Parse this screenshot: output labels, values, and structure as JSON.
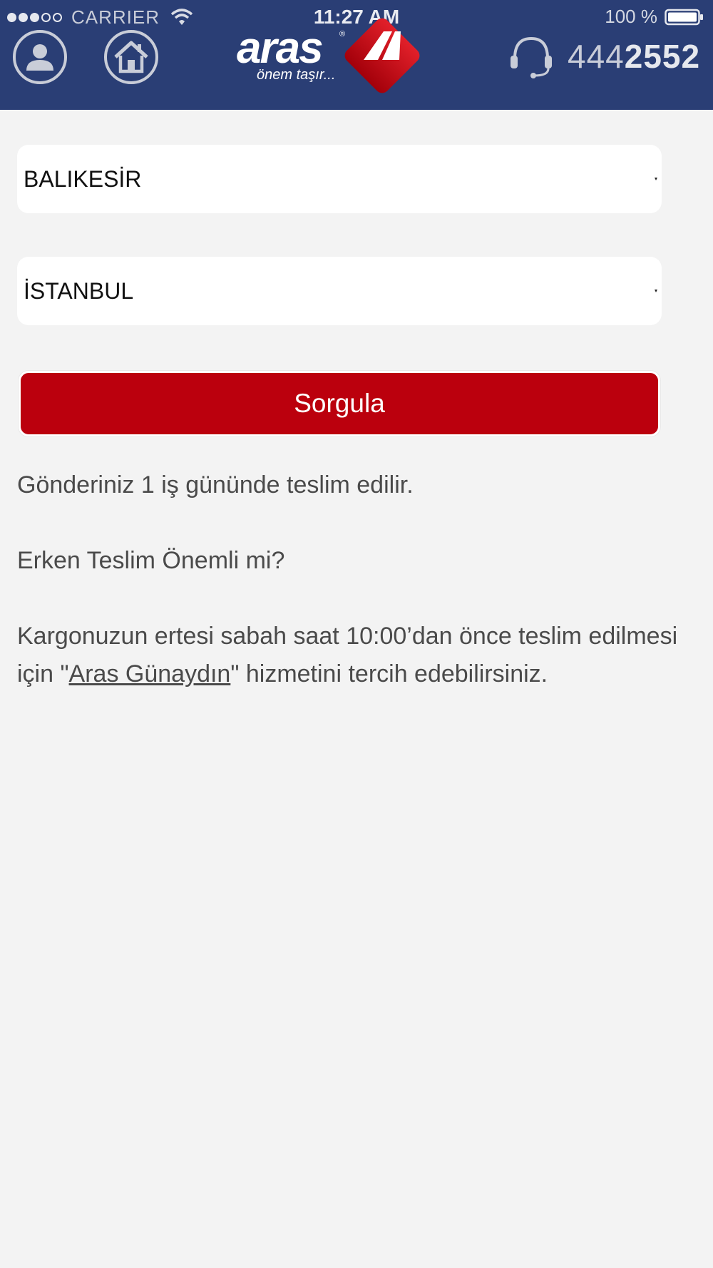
{
  "status_bar": {
    "carrier": "CARRIER",
    "time": "11:27 AM",
    "battery": "100 %",
    "signal_bars_filled": 3,
    "signal_bars_total": 5
  },
  "header": {
    "logo_text": "aras",
    "logo_registered": "®",
    "logo_tagline": "önem taşır...",
    "phone_prefix": "444",
    "phone_suffix": "2552",
    "background_color": "#2a3e75"
  },
  "form": {
    "origin_city": "BALIKESİR",
    "destination_city": "İSTANBUL",
    "submit_label": "Sorgula",
    "submit_color": "#bb000d"
  },
  "info": {
    "delivery_message": "Gönderiniz 1 iş gününde teslim edilir.",
    "early_question": "Erken Teslim Önemli mi?",
    "promo_prefix": "Kargonuzun ertesi sabah saat 10:00’dan önce teslim edilmesi için \"",
    "promo_link": "Aras Günaydın",
    "promo_suffix": "\" hizmetini tercih edebilirsiniz."
  },
  "icons": {
    "profile": "user-icon",
    "home": "home-icon",
    "support": "headset-icon",
    "wifi": "wifi-icon",
    "battery": "battery-icon"
  }
}
